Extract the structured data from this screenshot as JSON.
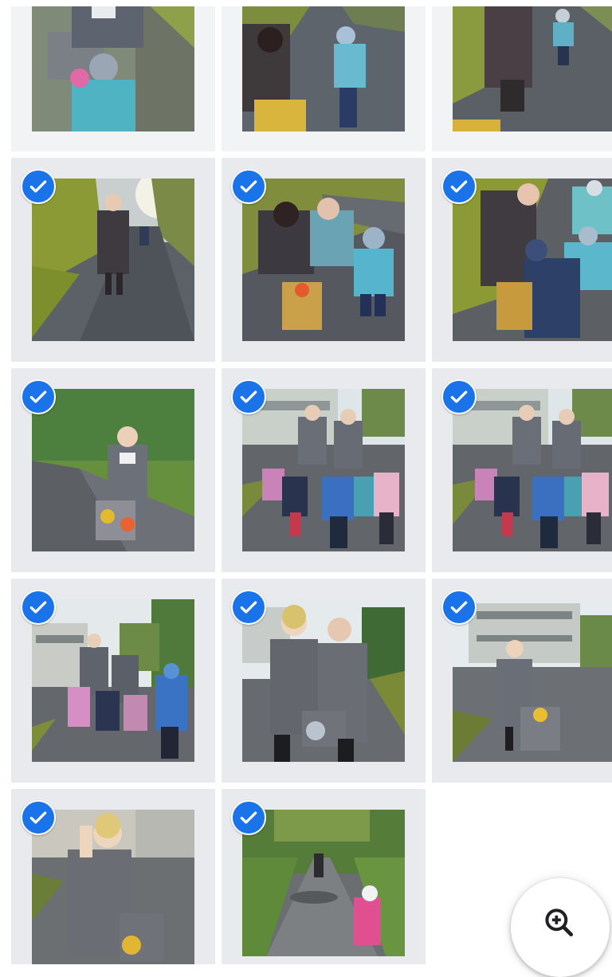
{
  "gallery": {
    "photos": [
      {
        "id": "p1",
        "selected": false,
        "scene": "teacher-child-table"
      },
      {
        "id": "p2",
        "selected": false,
        "scene": "woman-child-path"
      },
      {
        "id": "p3",
        "selected": false,
        "scene": "woman-walking-path"
      },
      {
        "id": "p4",
        "selected": true,
        "scene": "woman-walking-alley"
      },
      {
        "id": "p5",
        "selected": true,
        "scene": "women-bending-child"
      },
      {
        "id": "p6",
        "selected": true,
        "scene": "women-children-chair"
      },
      {
        "id": "p7",
        "selected": true,
        "scene": "woman-chair-garden"
      },
      {
        "id": "p8",
        "selected": true,
        "scene": "group-building"
      },
      {
        "id": "p9",
        "selected": true,
        "scene": "group-building"
      },
      {
        "id": "p10",
        "selected": true,
        "scene": "group-children"
      },
      {
        "id": "p11",
        "selected": true,
        "scene": "two-women"
      },
      {
        "id": "p12",
        "selected": true,
        "scene": "woman-building"
      },
      {
        "id": "p13",
        "selected": true,
        "scene": "woman-waving"
      },
      {
        "id": "p14",
        "selected": true,
        "scene": "child-pink-alley"
      }
    ],
    "select_icon": "check-circle-icon",
    "accent_color": "#1a73e8"
  },
  "fab": {
    "icon": "zoom-in-icon"
  }
}
